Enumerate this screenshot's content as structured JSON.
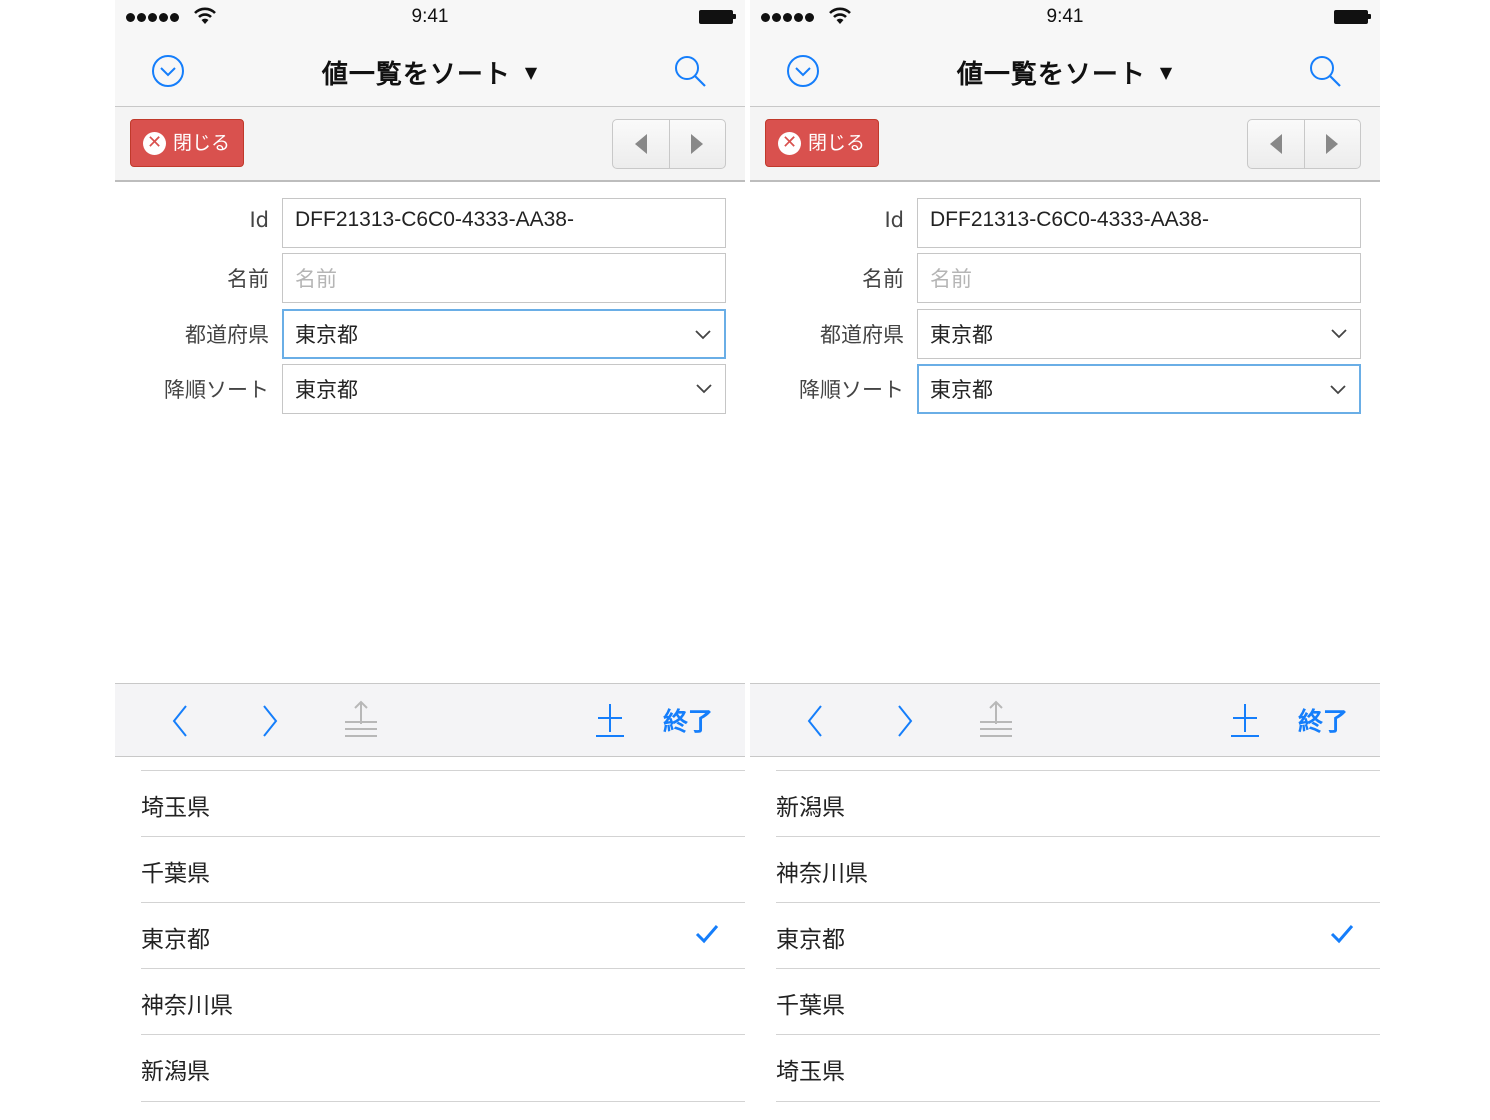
{
  "status": {
    "time": "9:41"
  },
  "nav": {
    "title": "値一覧をソート",
    "caret": "▼"
  },
  "toolbar": {
    "close_label": "閉じる"
  },
  "form": {
    "labels": {
      "id": "Id",
      "name": "名前",
      "prefecture": "都道府県",
      "desc_sort": "降順ソート"
    },
    "id_value": "DFF21313-C6C0-4333-AA38-",
    "name_placeholder": "名前",
    "prefecture_value": "東京都",
    "desc_sort_value": "東京都"
  },
  "keyboard_bar": {
    "done_label": "終了"
  },
  "screens": [
    {
      "focused_field": "prefecture",
      "picker": [
        "埼玉県",
        "千葉県",
        "東京都",
        "神奈川県",
        "新潟県"
      ],
      "selected": "東京都"
    },
    {
      "focused_field": "desc_sort",
      "picker": [
        "新潟県",
        "神奈川県",
        "東京都",
        "千葉県",
        "埼玉県"
      ],
      "selected": "東京都"
    }
  ],
  "colors": {
    "accent": "#157efb",
    "close_button": "#d9514e",
    "focus_border": "#6aaee6"
  },
  "icons": [
    "chevron-down-circle-icon",
    "search-icon",
    "close-x-icon",
    "prev-triangle-icon",
    "next-triangle-icon",
    "chevron-down-icon",
    "prev-chevron-icon",
    "next-chevron-icon",
    "share-icon",
    "plus-icon",
    "checkmark-icon"
  ]
}
